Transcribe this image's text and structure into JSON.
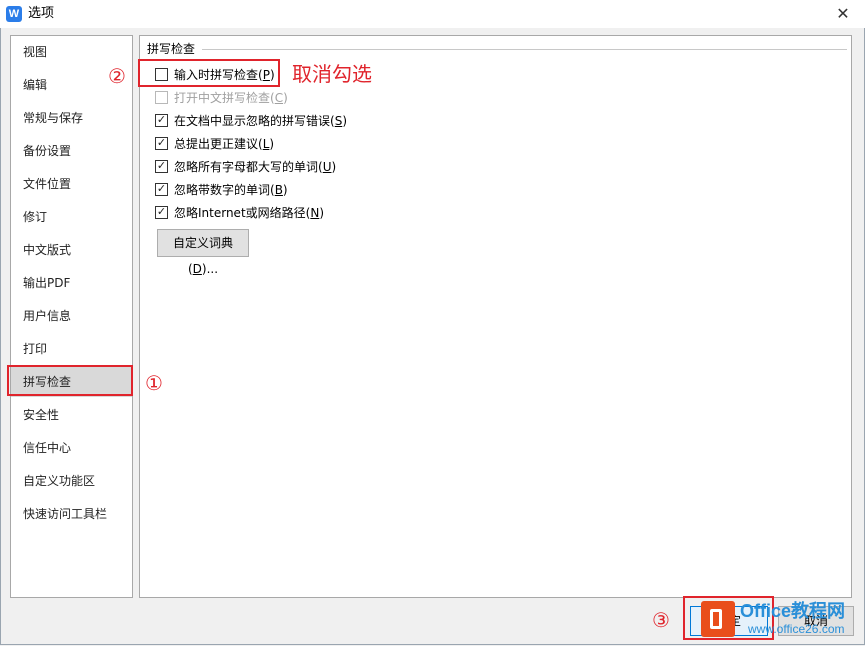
{
  "window": {
    "title": "选项",
    "close_glyph": "✕",
    "app_icon_letter": "W"
  },
  "nav": {
    "items": [
      {
        "label": "视图",
        "selected": false
      },
      {
        "label": "编辑",
        "selected": false
      },
      {
        "label": "常规与保存",
        "selected": false
      },
      {
        "label": "备份设置",
        "selected": false
      },
      {
        "label": "文件位置",
        "selected": false
      },
      {
        "label": "修订",
        "selected": false
      },
      {
        "label": "中文版式",
        "selected": false
      },
      {
        "label": "输出PDF",
        "selected": false
      },
      {
        "label": "用户信息",
        "selected": false
      },
      {
        "label": "打印",
        "selected": false
      },
      {
        "label": "拼写检查",
        "selected": true
      },
      {
        "label": "安全性",
        "selected": false
      },
      {
        "label": "信任中心",
        "selected": false
      },
      {
        "label": "自定义功能区",
        "selected": false
      },
      {
        "label": "快速访问工具栏",
        "selected": false
      }
    ]
  },
  "spellcheck": {
    "section_title": "拼写检查",
    "options": [
      {
        "text": "输入时拼写检查(",
        "key": "P",
        "checked": false,
        "disabled": false
      },
      {
        "text": "打开中文拼写检查(",
        "key": "C",
        "checked": false,
        "disabled": true
      },
      {
        "text": "在文档中显示忽略的拼写错误(",
        "key": "S",
        "checked": true,
        "disabled": false
      },
      {
        "text": "总提出更正建议(",
        "key": "L",
        "checked": true,
        "disabled": false
      },
      {
        "text": "忽略所有字母都大写的单词(",
        "key": "U",
        "checked": true,
        "disabled": false
      },
      {
        "text": "忽略带数字的单词(",
        "key": "B",
        "checked": true,
        "disabled": false
      },
      {
        "text": "忽略Internet或网络路径(",
        "key": "N",
        "checked": true,
        "disabled": false
      }
    ],
    "custom_dict_text": "自定义词典(",
    "custom_dict_key": "D",
    "custom_dict_suffix": ")..."
  },
  "footer": {
    "ok_label": "确定",
    "cancel_label": "取消"
  },
  "annotations": {
    "step1": "①",
    "step2": "②",
    "step3": "③",
    "note": "取消勾选",
    "color": "#e0242c"
  },
  "watermark": {
    "line1": "Office教程网",
    "line2": "www.office26.com"
  }
}
